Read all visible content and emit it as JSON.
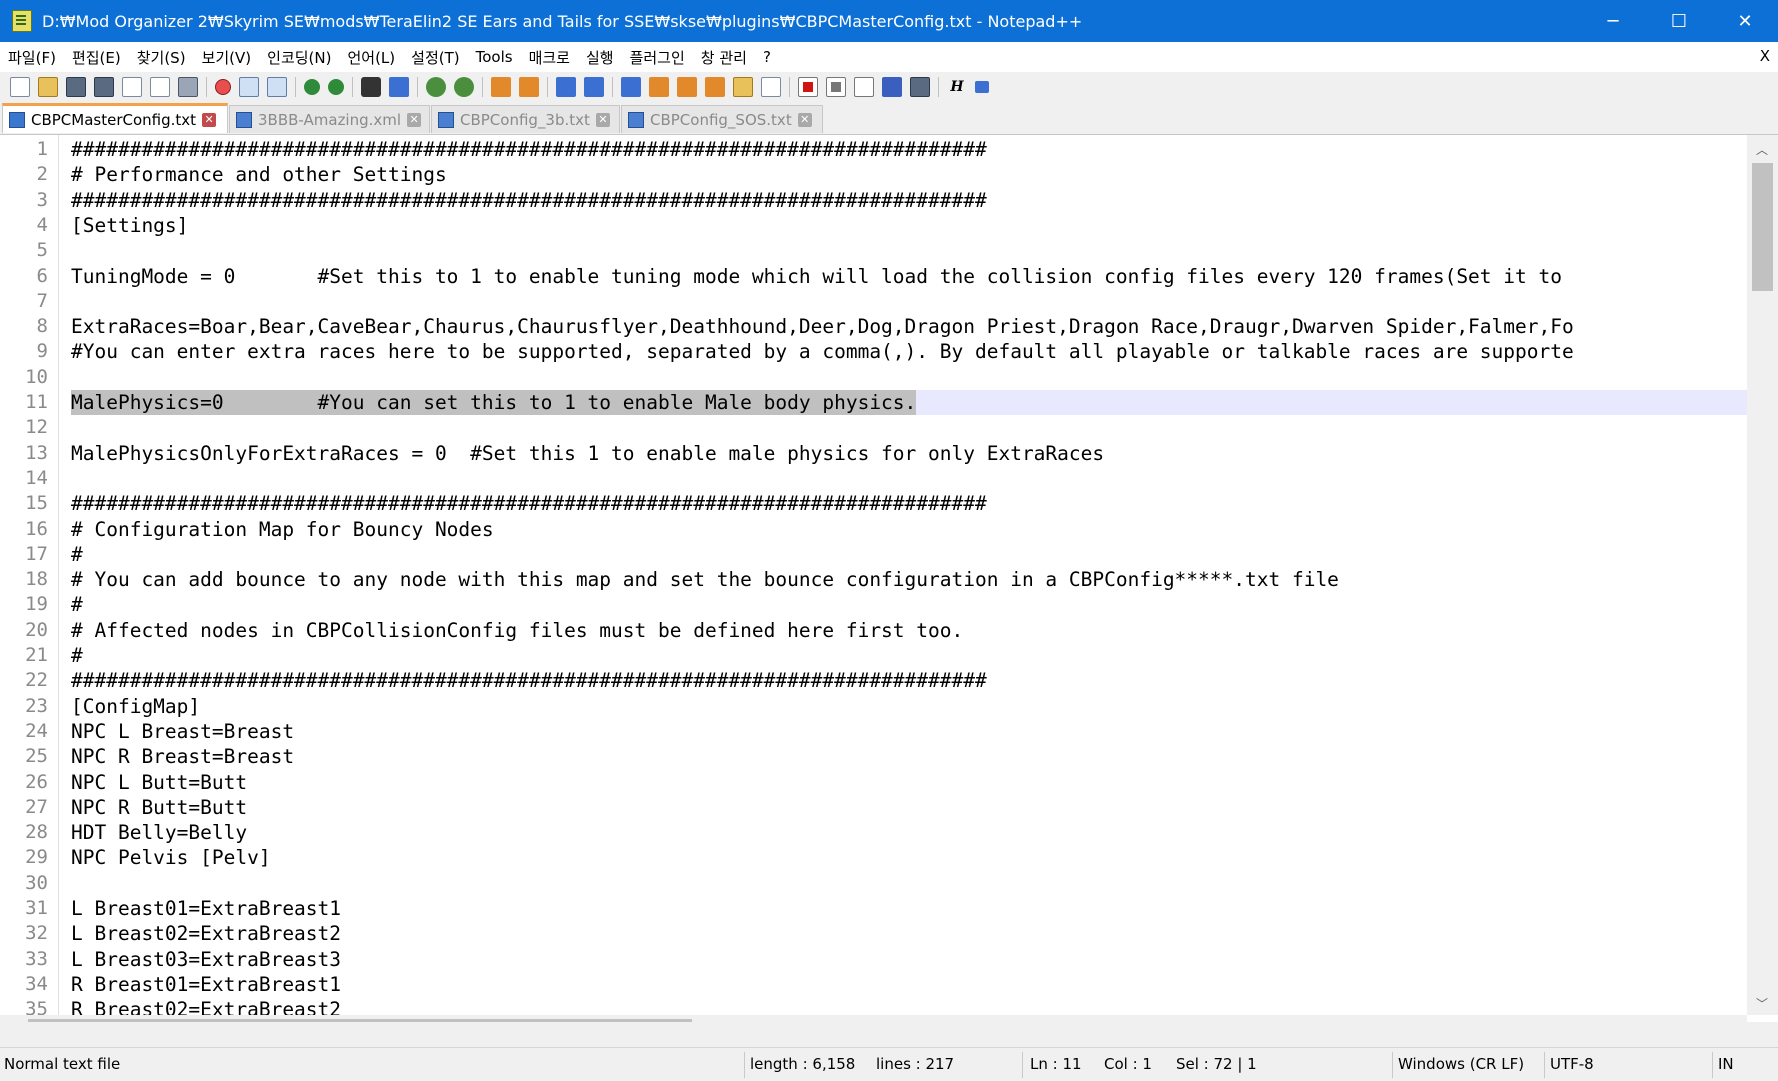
{
  "window": {
    "title": "D:₩Mod Organizer 2₩Skyrim SE₩mods₩TeraElin2 SE Ears and Tails for SSE₩skse₩plugins₩CBPCMasterConfig.txt - Notepad++",
    "minimize": "─",
    "maximize": "☐",
    "close": "✕"
  },
  "menu": {
    "items": [
      "파일(F)",
      "편집(E)",
      "찾기(S)",
      "보기(V)",
      "인코딩(N)",
      "언어(L)",
      "설정(T)",
      "Tools",
      "매크로",
      "실행",
      "플러그인",
      "창 관리",
      "?"
    ],
    "close_doc": "X"
  },
  "tabs": [
    {
      "label": "CBPCMasterConfig.txt",
      "active": true
    },
    {
      "label": "3BBB-Amazing.xml",
      "active": false
    },
    {
      "label": "CBPConfig_3b.txt",
      "active": false
    },
    {
      "label": "CBPConfig_SOS.txt",
      "active": false
    }
  ],
  "editor": {
    "line_numbers": [
      "1",
      "2",
      "3",
      "4",
      "5",
      "6",
      "7",
      "8",
      "9",
      "10",
      "11",
      "12",
      "13",
      "14",
      "15",
      "16",
      "17",
      "18",
      "19",
      "20",
      "21",
      "22",
      "23",
      "24",
      "25",
      "26",
      "27",
      "28",
      "29",
      "30",
      "31",
      "32",
      "33",
      "34",
      "35"
    ],
    "lines": [
      "##############################################################################",
      "# Performance and other Settings",
      "##############################################################################",
      "[Settings]",
      "",
      "TuningMode = 0       #Set this to 1 to enable tuning mode which will load the collision config files every 120 frames(Set it to",
      "",
      "ExtraRaces=Boar,Bear,CaveBear,Chaurus,Chaurusflyer,Deathhound,Deer,Dog,Dragon Priest,Dragon Race,Draugr,Dwarven Spider,Falmer,Fo",
      "#You can enter extra races here to be supported, separated by a comma(,). By default all playable or talkable races are supporte",
      "",
      "MalePhysics=0        #You can set this to 1 to enable Male body physics.",
      "",
      "MalePhysicsOnlyForExtraRaces = 0  #Set this 1 to enable male physics for only ExtraRaces",
      "",
      "##############################################################################",
      "# Configuration Map for Bouncy Nodes",
      "#",
      "# You can add bounce to any node with this map and set the bounce configuration in a CBPConfig*****.txt file",
      "#",
      "# Affected nodes in CBPCollisionConfig files must be defined here first too.",
      "#",
      "##############################################################################",
      "[ConfigMap]",
      "NPC L Breast=Breast",
      "NPC R Breast=Breast",
      "NPC L Butt=Butt",
      "NPC R Butt=Butt",
      "HDT Belly=Belly",
      "NPC Pelvis [Pelv]",
      "",
      "L Breast01=ExtraBreast1",
      "L Breast02=ExtraBreast2",
      "L Breast03=ExtraBreast3",
      "R Breast01=ExtraBreast1",
      "R Breast02=ExtraBreast2"
    ],
    "current_line": 11
  },
  "status": {
    "file_type": "Normal text file",
    "length": "length : 6,158",
    "lines": "lines : 217",
    "ln": "Ln : 11",
    "col": "Col : 1",
    "sel": "Sel : 72 | 1",
    "eol": "Windows (CR LF)",
    "encoding": "UTF-8",
    "mode": "IN"
  },
  "scroll_arrows": {
    "up": "︿",
    "down": "﹀",
    "left": "‹",
    "right": "›"
  }
}
